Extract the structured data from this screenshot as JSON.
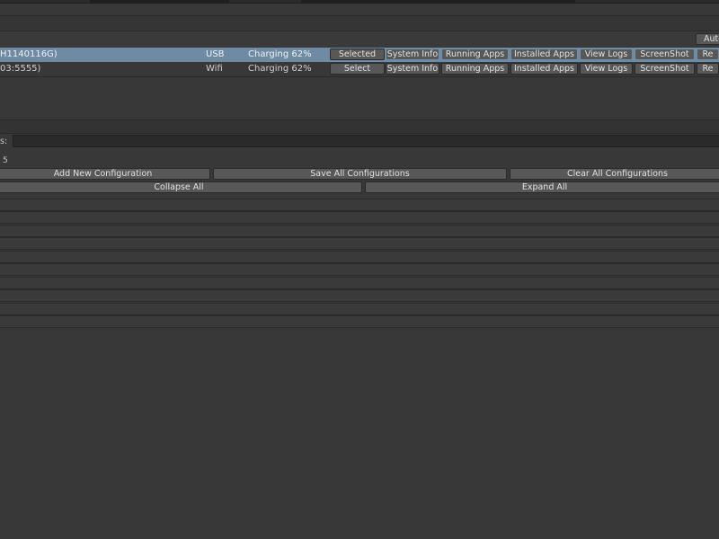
{
  "toolbar": {
    "auto_label": "Auto"
  },
  "devices": [
    {
      "name": "H1140116G)",
      "connection": "USB",
      "battery": "Charging 62%",
      "select_label": "Selected",
      "actions": [
        "System Info",
        "Running Apps",
        "Installed Apps",
        "View Logs",
        "ScreenShot",
        "Re"
      ]
    },
    {
      "name": "03:5555)",
      "connection": "Wifi",
      "battery": "Charging 62%",
      "select_label": "Select",
      "actions": [
        "System Info",
        "Running Apps",
        "Installed Apps",
        "View Logs",
        "ScreenShot",
        "Re"
      ]
    }
  ],
  "config": {
    "field_label": "s:",
    "field_value": "",
    "count": "5",
    "add_label": "Add New Configuration",
    "save_label": "Save All Configurations",
    "clear_label": "Clear All Configurations",
    "collapse_label": "Collapse All",
    "expand_label": "Expand All"
  }
}
